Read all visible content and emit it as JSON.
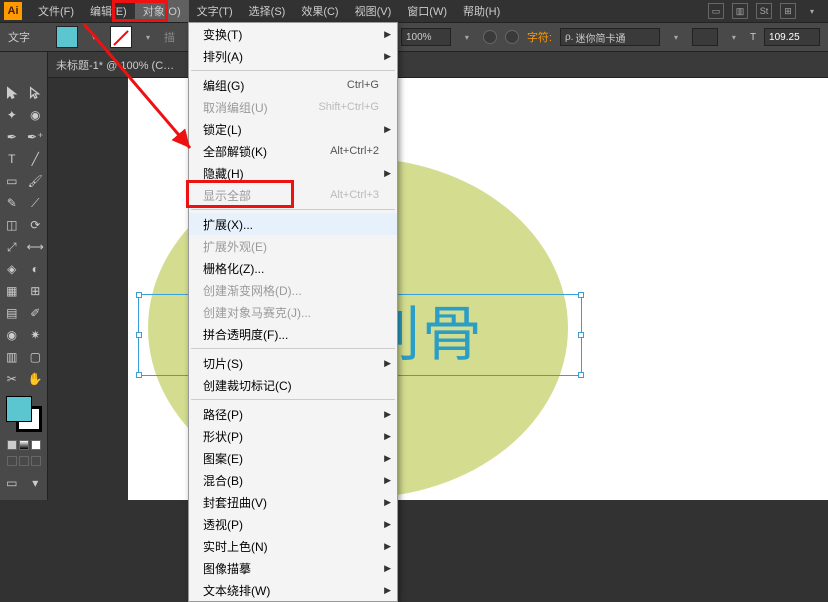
{
  "menubar": {
    "logo": "Ai",
    "items": [
      "文件(F)",
      "编辑(E)",
      "对象(O)",
      "文字(T)",
      "选择(S)",
      "效果(C)",
      "视图(V)",
      "窗口(W)",
      "帮助(H)"
    ],
    "active_index": 2
  },
  "optbar": {
    "tool_label": "文字",
    "zoom": "100%",
    "char_label": "字符:",
    "font": "迷你简卡通",
    "size": "109.25"
  },
  "doc_tab": "未标题-1* @ 100% (C…",
  "canvas": {
    "text_content": "冰霜刺骨"
  },
  "dropdown": {
    "groups": [
      [
        {
          "label": "变换(T)",
          "sub": true
        },
        {
          "label": "排列(A)",
          "sub": true
        }
      ],
      [
        {
          "label": "编组(G)",
          "shortcut": "Ctrl+G"
        },
        {
          "label": "取消编组(U)",
          "shortcut": "Shift+Ctrl+G",
          "disabled": true
        },
        {
          "label": "锁定(L)",
          "sub": true
        },
        {
          "label": "全部解锁(K)",
          "shortcut": "Alt+Ctrl+2"
        },
        {
          "label": "隐藏(H)",
          "sub": true
        },
        {
          "label": "显示全部",
          "shortcut": "Alt+Ctrl+3",
          "disabled": true
        }
      ],
      [
        {
          "label": "扩展(X)...",
          "hover": true,
          "highlight": true
        },
        {
          "label": "扩展外观(E)",
          "disabled": true
        },
        {
          "label": "栅格化(Z)...",
          "sep_after": false
        },
        {
          "label": "创建渐变网格(D)...",
          "disabled": true
        },
        {
          "label": "创建对象马赛克(J)...",
          "disabled": true
        },
        {
          "label": "拼合透明度(F)..."
        }
      ],
      [
        {
          "label": "切片(S)",
          "sub": true
        },
        {
          "label": "创建裁切标记(C)"
        }
      ],
      [
        {
          "label": "路径(P)",
          "sub": true
        },
        {
          "label": "形状(P)",
          "sub": true
        },
        {
          "label": "图案(E)",
          "sub": true
        },
        {
          "label": "混合(B)",
          "sub": true
        },
        {
          "label": "封套扭曲(V)",
          "sub": true
        },
        {
          "label": "透视(P)",
          "sub": true
        },
        {
          "label": "实时上色(N)",
          "sub": true
        },
        {
          "label": "图像描摹",
          "sub": true
        },
        {
          "label": "文本绕排(W)",
          "sub": true
        }
      ]
    ]
  }
}
